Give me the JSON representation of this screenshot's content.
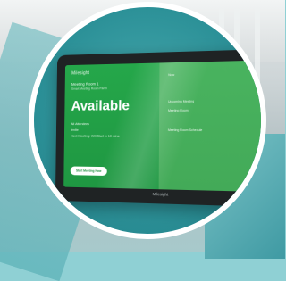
{
  "scene": {
    "tablet_brand": "Milesight",
    "screen": {
      "room_title": "Meeting Room 1",
      "room_subtitle": "Smart Meeting Room Panel",
      "status": "Available",
      "info_lines": [
        "All Attendees",
        "Invite",
        "Next Meeting: Will Start in 10 mins"
      ],
      "button_label": "Start Meeting Now"
    },
    "side_panel": {
      "items": [
        "Now",
        "Upcoming Meeting",
        "Meeting Room",
        "Meeting Room Schedule"
      ]
    }
  },
  "colors": {
    "screen_green": "#25a74a",
    "circle_teal": "#2a8f96",
    "frame": "#1f2324"
  }
}
